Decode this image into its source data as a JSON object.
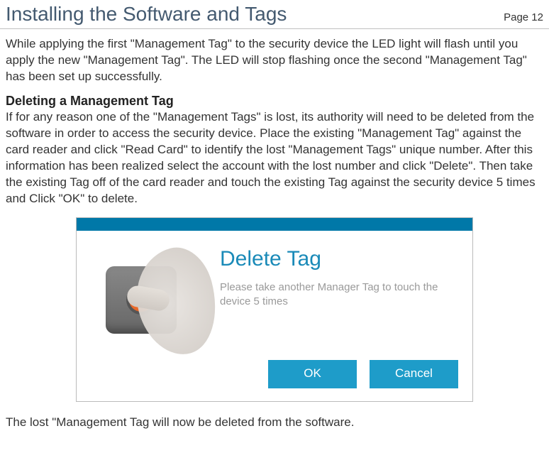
{
  "header": {
    "title": "Installing the Software and Tags",
    "page_label": "Page 12"
  },
  "body": {
    "para1": "While applying the first \"Management Tag\" to the security device the LED light will flash until you apply the new \"Management Tag\". The LED will stop flashing once the second \"Management Tag\" has been set up successfully.",
    "subhead": "Deleting a Management Tag",
    "para2": "If for any reason one of the \"Management Tags\" is lost, its authority will need to be deleted from the software in order to access the security device. Place the existing \"Management Tag\" against the card reader and click \"Read Card\" to identify the lost \"Management Tags\" unique number. After this information has been realized select the account with the lost number and click \"Delete\". Then take the existing Tag off of the card reader and  touch the existing  Tag against the security device 5 times and Click \"OK\" to delete.",
    "para3": "The lost \"Management Tag will now be deleted from the software."
  },
  "dialog": {
    "title": "Delete Tag",
    "message": "Please take another Manager Tag to touch the device 5 times",
    "ok_label": "OK",
    "cancel_label": "Cancel"
  },
  "colors": {
    "accent": "#1e9cc9",
    "heading": "#445a70"
  }
}
